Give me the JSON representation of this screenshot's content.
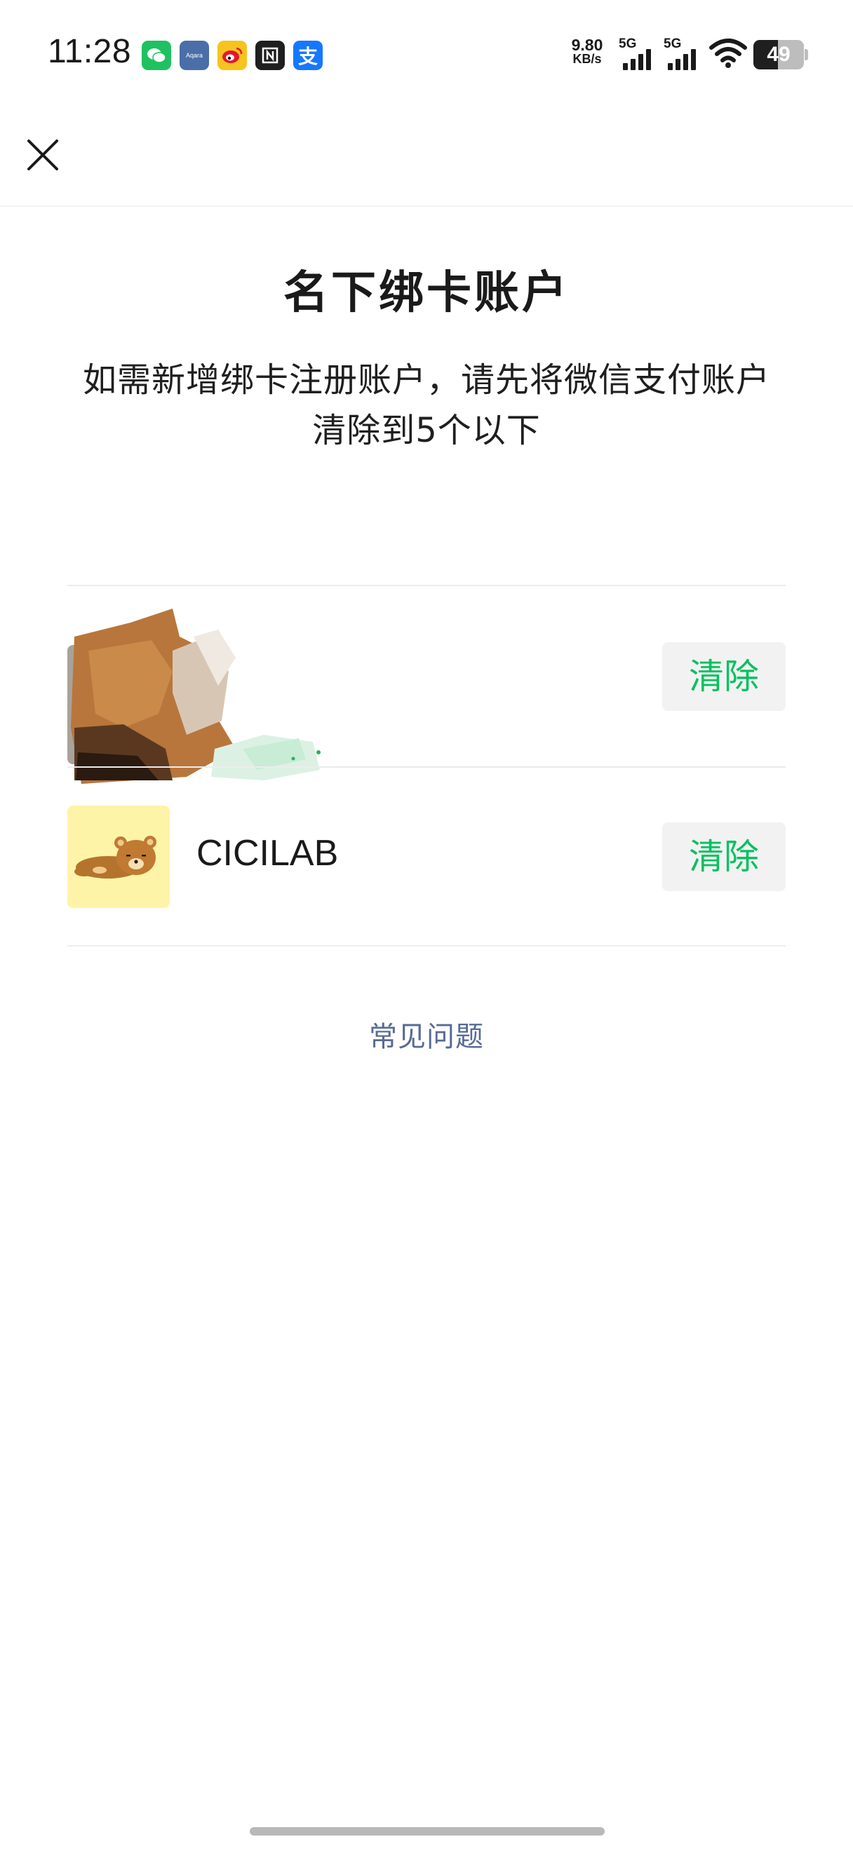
{
  "status_bar": {
    "time": "11:28",
    "app_icons": [
      "wechat-icon",
      "aqara-icon",
      "weibo-icon",
      "notion-icon",
      "alipay-icon"
    ],
    "aqara_label": "Aqara",
    "alipay_glyph": "支",
    "net_speed": {
      "value": "9.80",
      "unit": "KB/s"
    },
    "signal_1": "5G",
    "signal_2": "5G",
    "battery_level": "49",
    "battery_fraction": 0.49
  },
  "nav": {
    "close_icon": "close-icon"
  },
  "page": {
    "title": "名下绑卡账户",
    "description": "如需新增绑卡注册账户，请先将微信支付账户清除到5个以下"
  },
  "accounts": [
    {
      "name": "",
      "clear_label": "清除"
    },
    {
      "name": "CICILAB",
      "clear_label": "清除"
    }
  ],
  "faq_label": "常见问题",
  "colors": {
    "accent_green": "#07c160",
    "link_blue": "#576b95",
    "button_bg": "#f2f2f2"
  }
}
